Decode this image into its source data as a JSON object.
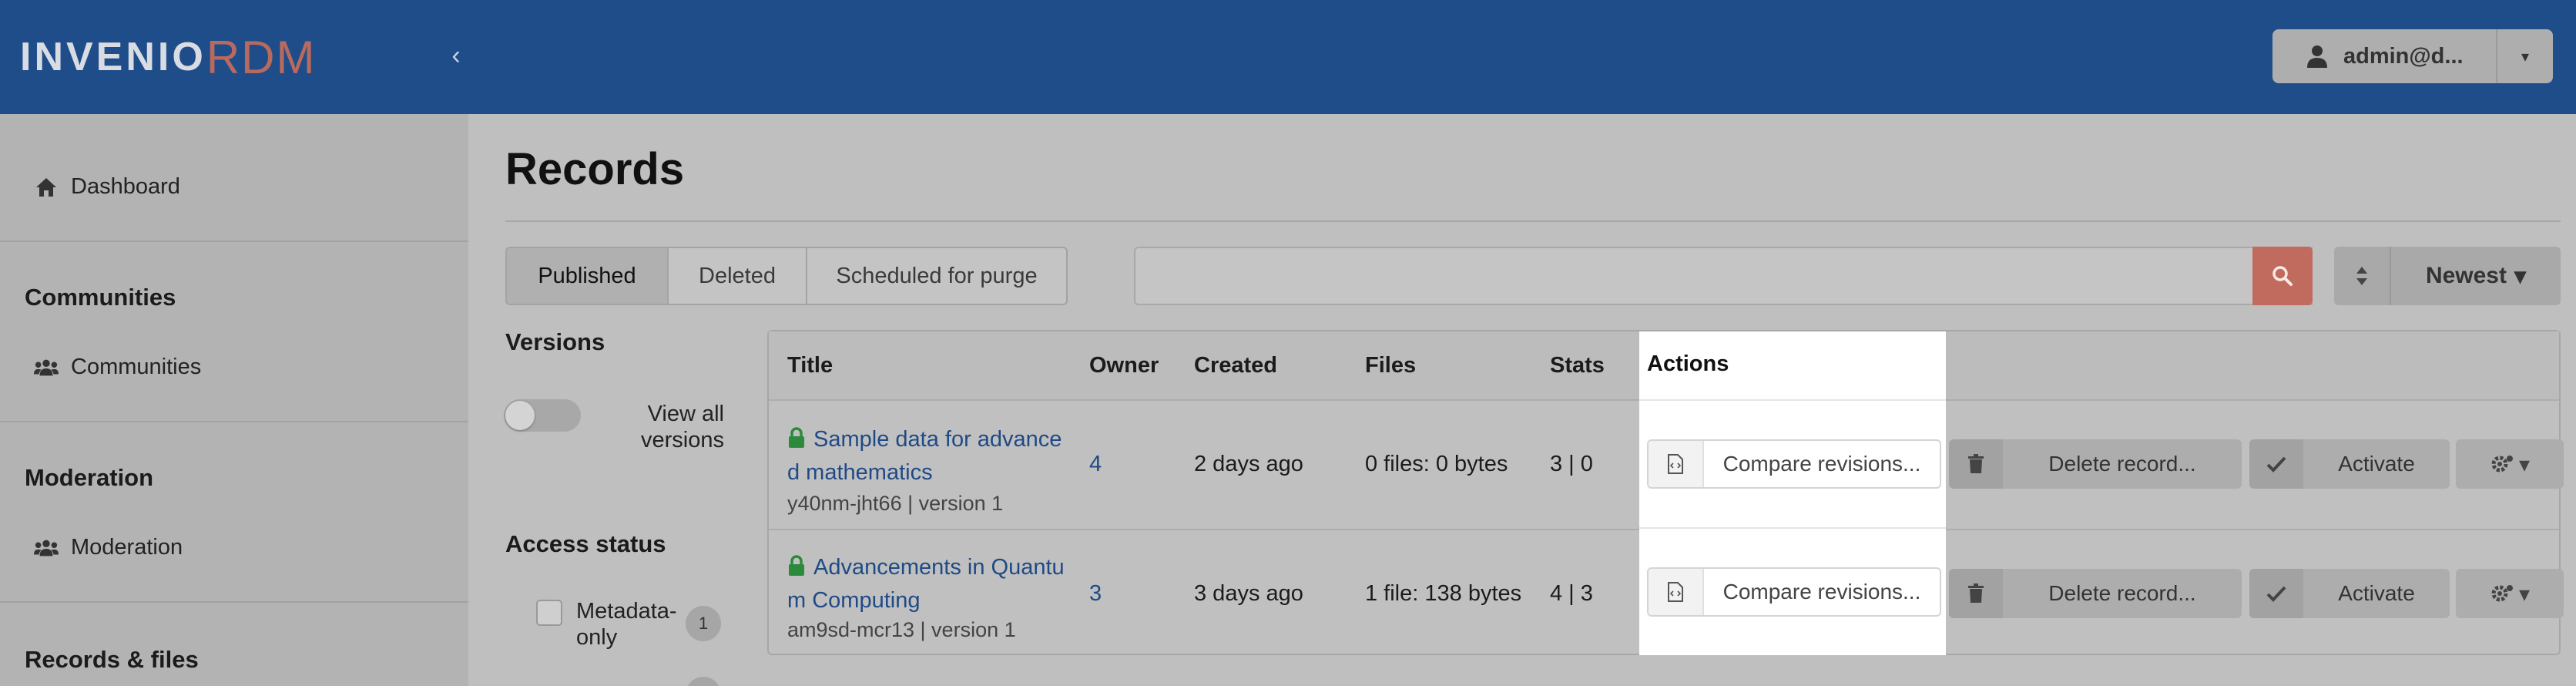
{
  "header": {
    "logo_part1": "INVENIO",
    "logo_part2": "RDM",
    "collapse_glyph": "‹",
    "user_label": "admin@d...",
    "caret": "▾",
    "colors": {
      "header_bg": "#1f4d8a",
      "accent": "#c06b5d",
      "link": "#1f4a86"
    }
  },
  "sidebar": {
    "dashboard": {
      "label": "Dashboard",
      "icon": "home-icon"
    },
    "communities_heading": "Communities",
    "communities": {
      "label": "Communities",
      "icon": "users-icon"
    },
    "moderation_heading": "Moderation",
    "moderation": {
      "label": "Moderation",
      "icon": "users-icon"
    },
    "records_heading": "Records & files"
  },
  "main": {
    "title": "Records",
    "tabs": [
      {
        "label": "Published",
        "active": true
      },
      {
        "label": "Deleted",
        "active": false
      },
      {
        "label": "Scheduled for purge",
        "active": false
      }
    ],
    "search": {
      "placeholder": "",
      "icon": "search-icon"
    },
    "sort": {
      "label": "Newest",
      "icon": "sort-icon"
    }
  },
  "facets": {
    "versions_heading": "Versions",
    "view_all_label": "View all versions",
    "view_all_on": false,
    "access_heading": "Access status",
    "access_options": [
      {
        "label": "Metadata-only",
        "count": "1",
        "checked": false
      }
    ]
  },
  "table": {
    "headers": {
      "title": "Title",
      "owner": "Owner",
      "created": "Created",
      "files": "Files",
      "stats": "Stats",
      "actions": "Actions"
    },
    "rows": [
      {
        "title": "Sample data for advanced mathematics",
        "id_version": "y40nm-jht66 | version 1",
        "owner": "4",
        "created": "2 days ago",
        "files": "0 files: 0 bytes",
        "stats": "3 | 0"
      },
      {
        "title": "Advancements in Quantum Computing",
        "id_version": "am9sd-mcr13 | version 1",
        "owner": "3",
        "created": "3 days ago",
        "files": "1 file: 138 bytes",
        "stats": "4 | 3"
      }
    ],
    "actions": {
      "compare": "Compare revisions...",
      "delete": "Delete record...",
      "activate": "Activate",
      "gear_caret": "▾"
    }
  }
}
